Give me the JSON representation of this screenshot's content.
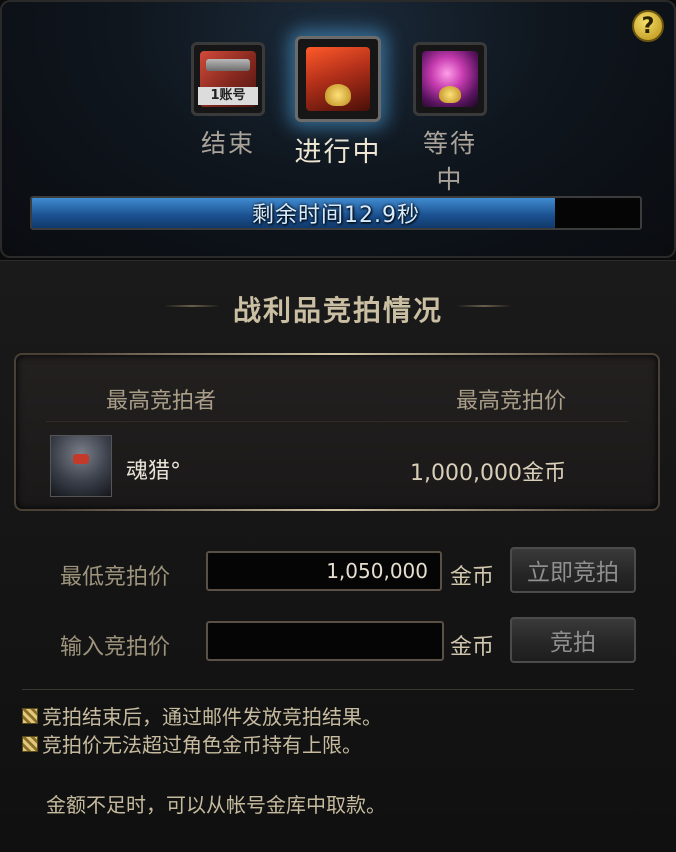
{
  "help": {
    "label": "?"
  },
  "stages": [
    {
      "label": "结束",
      "icon": "ended-chest-icon",
      "stamp": "1账号"
    },
    {
      "label": "进行中",
      "icon": "red-treasure-chest-icon",
      "active": true
    },
    {
      "label": "等待中",
      "icon": "pink-crystal-chest-icon"
    }
  ],
  "timer": {
    "text": "剩余时间12.9秒",
    "progress": 0.86,
    "color": "#2a6fb8"
  },
  "section_title": "战利品竞拍情况",
  "bid_status": {
    "header_bidder": "最高竞拍者",
    "header_price": "最高竞拍价",
    "bidder_name": "魂猎°",
    "bid_price": "1,000,000金币"
  },
  "form": {
    "min_label": "最低竞拍价",
    "min_value": "1,050,000",
    "min_unit": "金币",
    "instant_bid_label": "立即竞拍",
    "input_label": "输入竞拍价",
    "input_value": "",
    "input_unit": "金币",
    "bid_label": "竞拍"
  },
  "notices": [
    "竞拍结束后，通过邮件发放竞拍结果。",
    "竞拍价无法超过角色金币持有上限。"
  ],
  "footer_note": "金额不足时，可以从帐号金库中取款。"
}
